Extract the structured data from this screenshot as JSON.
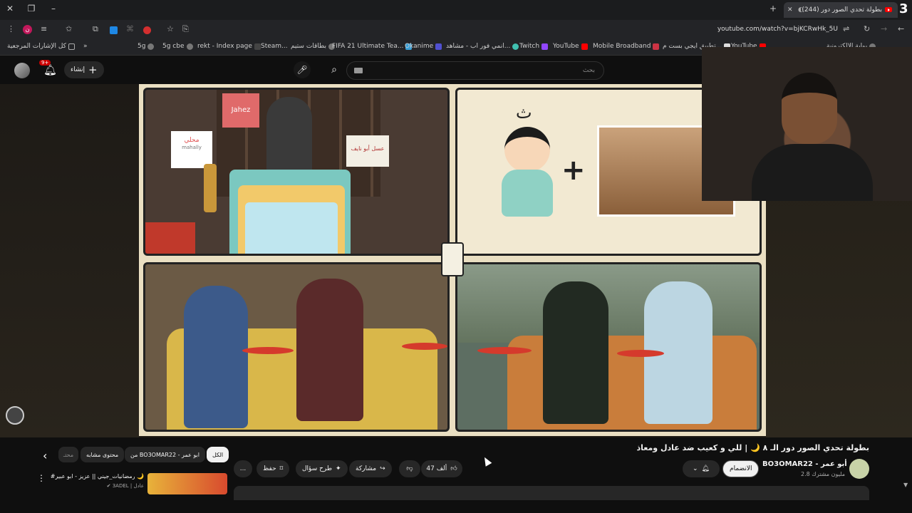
{
  "browser": {
    "tab_title": "(244) بطولة تحدي الصور دور",
    "badge_number": "3",
    "url": "youtube.com/watch?v=bjKCRwHk_5U"
  },
  "bookmarks": [
    {
      "label": "كل الإشارات المرجعية",
      "color": "#aaaaaa"
    },
    {
      "label": "5g",
      "color": "#888888"
    },
    {
      "label": "5g cbe",
      "color": "#888888"
    },
    {
      "label": "rekt - Index page",
      "color": "#555555"
    },
    {
      "label": "Steam...",
      "color": "#1b2838"
    },
    {
      "label": "بطاقات ستيم",
      "color": "#888888"
    },
    {
      "label": "FIFA 21 Ultimate Tea...",
      "color": "#3aa0d8"
    },
    {
      "label": "Okanime",
      "color": "#5050d0"
    },
    {
      "label": "انمي فور اب - مشاهد...",
      "color": "#40c0b0"
    },
    {
      "label": "Twitch",
      "color": "#9146ff"
    },
    {
      "label": "YouTube",
      "color": "#ff0000"
    },
    {
      "label": "Mobile Broadband",
      "color": "#cc3344"
    },
    {
      "label": "تطبيق ايجي بست م...",
      "color": "#dddddd"
    },
    {
      "label": "YouTube",
      "color": "#ff0000"
    },
    {
      "label": "بوابة الإلكترونية",
      "color": "#888888"
    }
  ],
  "youtube": {
    "create_label": "إنشاء",
    "notif_count": "9+",
    "search_placeholder": "بحث",
    "video_title": "بطولة تحدي الصور دور الـ ٨ 🌙 | للي و كعيب ضد عادل ومعاذ",
    "channel_name": "BO3OMAR22 - أبو عمر",
    "subscribers": "2.8 مليون مشترك",
    "join_label": "الانضمام",
    "likes": "47 ألف",
    "share_label": "مشاركة",
    "ask_label": "طرح سؤال",
    "save_label": "حفظ",
    "more_label": "...",
    "chips": [
      "الكل",
      "من BO3OMAR22 - ابو عمر",
      "محتوى مشابه",
      "محتـ"
    ],
    "rec_title": "#رمضانيات_جيني || عزيز - ابو عبير 🌙",
    "rec_channel": "3ADEL | عادل",
    "overlay_icons": [
      "Jahez",
      "محلي",
      "mahally",
      "عسل أبو نايف"
    ]
  },
  "colors": {
    "accent_red": "#ff0000",
    "bg": "#0f0f0f",
    "chip_active_bg": "#f1f1f1"
  }
}
